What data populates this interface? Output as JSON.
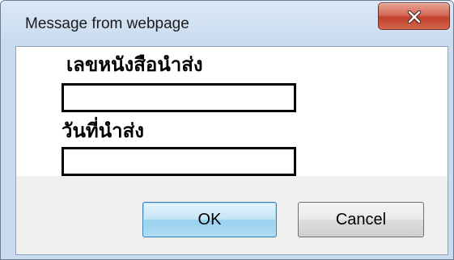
{
  "dialog": {
    "title": "Message from webpage",
    "close_icon": "close-x-icon",
    "fields": [
      {
        "label": "เลขหนังสือนำส่ง",
        "value": ""
      },
      {
        "label": "วันที่นำส่ง",
        "value": ""
      }
    ],
    "buttons": {
      "ok_label": "OK",
      "cancel_label": "Cancel"
    }
  },
  "colors": {
    "frame": "#c9dcef",
    "close_button": "#c7402d",
    "ok_button_accent": "#98d1ef",
    "button_bar": "#f0f0f0"
  }
}
